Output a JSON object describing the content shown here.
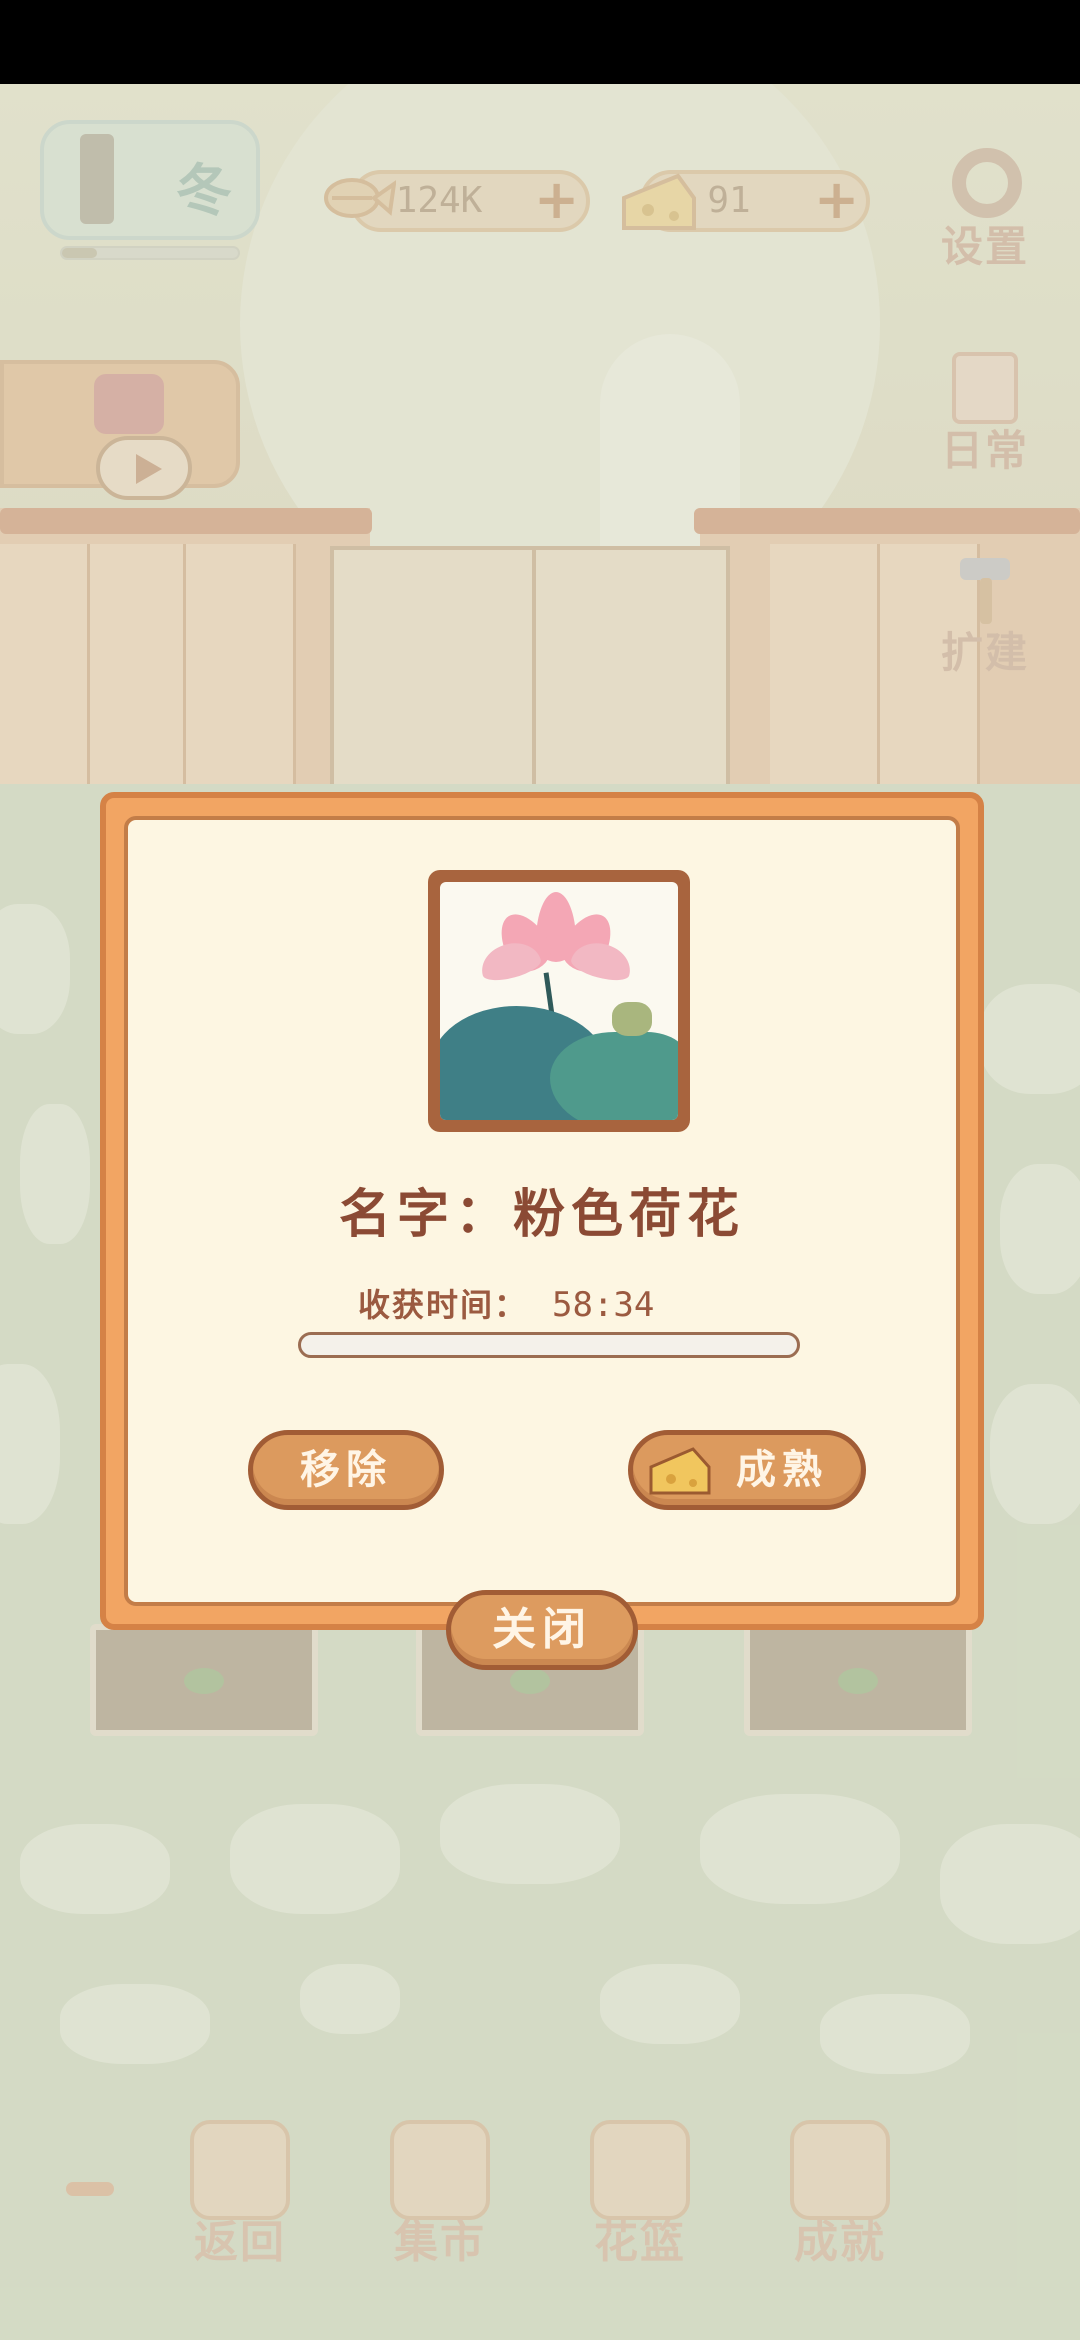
{
  "hud": {
    "season_label": "冬",
    "fish_count": "124K",
    "cheese_count": "91",
    "plus_symbol": "+",
    "season_progress": 0.2
  },
  "side_menu": {
    "settings": "设置",
    "daily": "日常",
    "expand": "扩建"
  },
  "dialog": {
    "name_text": "名字：粉色荷花",
    "harvest_label": "收获时间：",
    "harvest_time": "58:34",
    "progress": 0,
    "remove_label": "移除",
    "ripen_label": "成熟",
    "close_label": "关闭"
  },
  "bottom_nav": {
    "back": "返回",
    "market": "集市",
    "basket": "花篮",
    "achievements": "成就"
  },
  "colors": {
    "dialog_border": "#f2a563",
    "dialog_bg": "#fdf6e2",
    "button": "#dc9a5e",
    "text_brown": "#8b4a34"
  }
}
